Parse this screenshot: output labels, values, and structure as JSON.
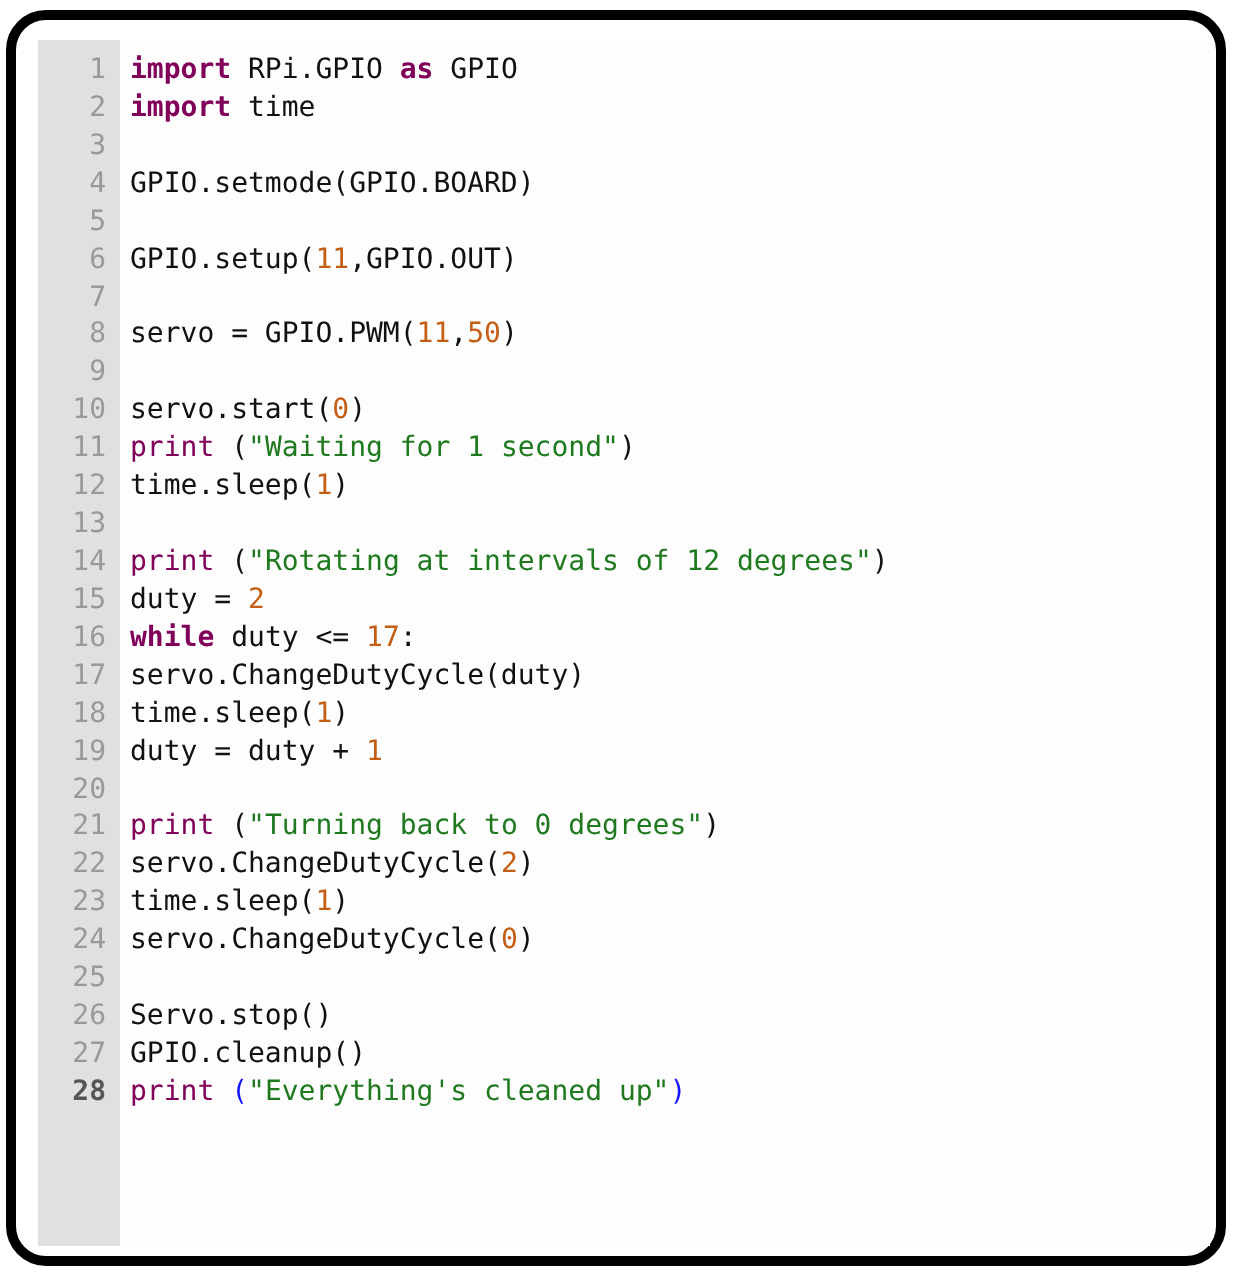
{
  "editor": {
    "lines": [
      {
        "number": "1",
        "active": false,
        "tokens": [
          {
            "kind": "keyword",
            "text": "import"
          },
          {
            "kind": "plain",
            "text": " RPi.GPIO "
          },
          {
            "kind": "keyword",
            "text": "as"
          },
          {
            "kind": "plain",
            "text": " GPIO"
          }
        ]
      },
      {
        "number": "2",
        "active": false,
        "tokens": [
          {
            "kind": "keyword",
            "text": "import"
          },
          {
            "kind": "plain",
            "text": " time"
          }
        ]
      },
      {
        "number": "3",
        "active": false
      },
      {
        "number": "4",
        "active": false,
        "tokens": [
          {
            "kind": "plain",
            "text": "GPIO.setmode(GPIO.BOARD)"
          }
        ]
      },
      {
        "number": "5",
        "active": false
      },
      {
        "number": "6",
        "active": false,
        "tokens": [
          {
            "kind": "plain",
            "text": "GPIO.setup("
          },
          {
            "kind": "number",
            "text": "11"
          },
          {
            "kind": "plain",
            "text": ",GPIO.OUT)"
          }
        ]
      },
      {
        "number": "7",
        "active": false
      },
      {
        "number": "8",
        "active": false,
        "tokens": [
          {
            "kind": "plain",
            "text": "servo = GPIO.PWM("
          },
          {
            "kind": "number",
            "text": "11"
          },
          {
            "kind": "plain",
            "text": ","
          },
          {
            "kind": "number",
            "text": "50"
          },
          {
            "kind": "plain",
            "text": ")"
          }
        ]
      },
      {
        "number": "9",
        "active": false
      },
      {
        "number": "10",
        "active": false,
        "tokens": [
          {
            "kind": "plain",
            "text": "servo.start("
          },
          {
            "kind": "number",
            "text": "0"
          },
          {
            "kind": "plain",
            "text": ")"
          }
        ]
      },
      {
        "number": "11",
        "active": false,
        "tokens": [
          {
            "kind": "builtin",
            "text": "print"
          },
          {
            "kind": "plain",
            "text": " ("
          },
          {
            "kind": "string",
            "text": "\"Waiting for 1 second\""
          },
          {
            "kind": "plain",
            "text": ")"
          }
        ]
      },
      {
        "number": "12",
        "active": false,
        "tokens": [
          {
            "kind": "plain",
            "text": "time.sleep("
          },
          {
            "kind": "number",
            "text": "1"
          },
          {
            "kind": "plain",
            "text": ")"
          }
        ]
      },
      {
        "number": "13",
        "active": false
      },
      {
        "number": "14",
        "active": false,
        "tokens": [
          {
            "kind": "builtin",
            "text": "print"
          },
          {
            "kind": "plain",
            "text": " ("
          },
          {
            "kind": "string",
            "text": "\"Rotating at intervals of 12 degrees\""
          },
          {
            "kind": "plain",
            "text": ")"
          }
        ]
      },
      {
        "number": "15",
        "active": false,
        "tokens": [
          {
            "kind": "plain",
            "text": "duty = "
          },
          {
            "kind": "number",
            "text": "2"
          }
        ]
      },
      {
        "number": "16",
        "active": false,
        "tokens": [
          {
            "kind": "keyword",
            "text": "while"
          },
          {
            "kind": "plain",
            "text": " duty <= "
          },
          {
            "kind": "number",
            "text": "17"
          },
          {
            "kind": "plain",
            "text": ":"
          }
        ]
      },
      {
        "number": "17",
        "active": false,
        "tokens": [
          {
            "kind": "plain",
            "text": "servo.ChangeDutyCycle(duty)"
          }
        ]
      },
      {
        "number": "18",
        "active": false,
        "tokens": [
          {
            "kind": "plain",
            "text": "time.sleep("
          },
          {
            "kind": "number",
            "text": "1"
          },
          {
            "kind": "plain",
            "text": ")"
          }
        ]
      },
      {
        "number": "19",
        "active": false,
        "tokens": [
          {
            "kind": "plain",
            "text": "duty = duty + "
          },
          {
            "kind": "number",
            "text": "1"
          }
        ]
      },
      {
        "number": "20",
        "active": false
      },
      {
        "number": "21",
        "active": false,
        "tokens": [
          {
            "kind": "builtin",
            "text": "print"
          },
          {
            "kind": "plain",
            "text": " ("
          },
          {
            "kind": "string",
            "text": "\"Turning back to 0 degrees\""
          },
          {
            "kind": "plain",
            "text": ")"
          }
        ]
      },
      {
        "number": "22",
        "active": false,
        "tokens": [
          {
            "kind": "plain",
            "text": "servo.ChangeDutyCycle("
          },
          {
            "kind": "number",
            "text": "2"
          },
          {
            "kind": "plain",
            "text": ")"
          }
        ]
      },
      {
        "number": "23",
        "active": false,
        "tokens": [
          {
            "kind": "plain",
            "text": "time.sleep("
          },
          {
            "kind": "number",
            "text": "1"
          },
          {
            "kind": "plain",
            "text": ")"
          }
        ]
      },
      {
        "number": "24",
        "active": false,
        "tokens": [
          {
            "kind": "plain",
            "text": "servo.ChangeDutyCycle("
          },
          {
            "kind": "number",
            "text": "0"
          },
          {
            "kind": "plain",
            "text": ")"
          }
        ]
      },
      {
        "number": "25",
        "active": false
      },
      {
        "number": "26",
        "active": false,
        "tokens": [
          {
            "kind": "plain",
            "text": "Servo.stop()"
          }
        ]
      },
      {
        "number": "27",
        "active": false,
        "tokens": [
          {
            "kind": "plain",
            "text": "GPIO.cleanup()"
          }
        ]
      },
      {
        "number": "28",
        "active": true,
        "tokens": [
          {
            "kind": "builtin",
            "text": "print "
          },
          {
            "kind": "bracket-match",
            "text": "("
          },
          {
            "kind": "string",
            "text": "\"Everything's cleaned up\""
          },
          {
            "kind": "bracket-match",
            "text": ")"
          }
        ]
      }
    ]
  }
}
